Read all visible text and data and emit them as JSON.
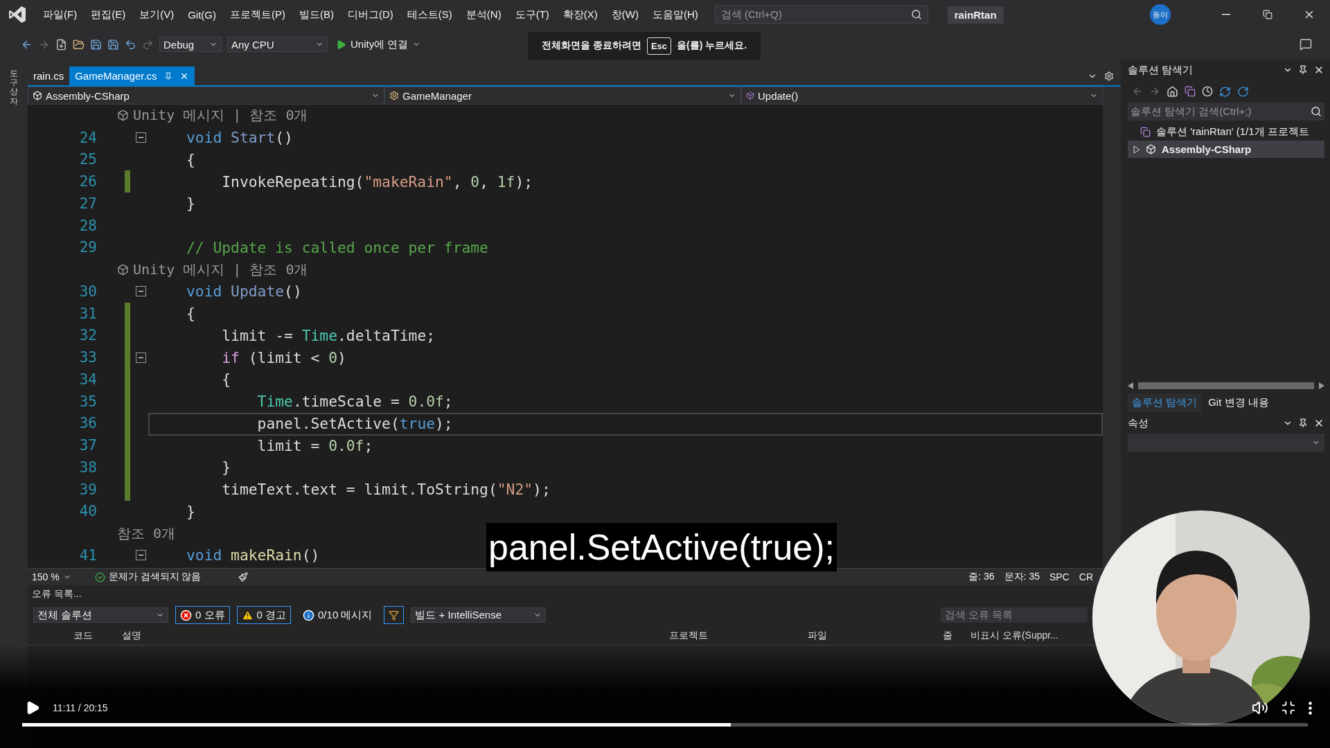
{
  "menu": [
    "파일(F)",
    "편집(E)",
    "보기(V)",
    "Git(G)",
    "프로젝트(P)",
    "빌드(B)",
    "디버그(D)",
    "테스트(S)",
    "분석(N)",
    "도구(T)",
    "확장(X)",
    "창(W)",
    "도움말(H)"
  ],
  "search": {
    "placeholder": "검색 (Ctrl+Q)"
  },
  "solution_name": "rainRtan",
  "avatar": "동이",
  "toolbar": {
    "configuration": "Debug",
    "platform": "Any CPU",
    "run": "Unity에 연결"
  },
  "fullscreen_notice": {
    "before": "전체화면을 종료하려면",
    "key": "Esc",
    "after": "을(를) 누르세요."
  },
  "toolbox_label": "도구 상자",
  "tabs": [
    {
      "label": "rain.cs",
      "selected": false
    },
    {
      "label": "GameManager.cs",
      "selected": true
    }
  ],
  "navigation": {
    "project": "Assembly-CSharp",
    "class": "GameManager",
    "member": "Update()"
  },
  "code_lines": [
    {
      "kind": "lens",
      "icon": true,
      "text": "Unity 메시지 | 참조 0개"
    },
    {
      "kind": "code",
      "number": "24",
      "fold": true,
      "changed": false,
      "current": false,
      "tokens": [
        {
          "text": "void",
          "kind": "keyword"
        },
        {
          "text": " Start",
          "kind": "message"
        },
        {
          "text": "()",
          "kind": "plain"
        }
      ]
    },
    {
      "kind": "code",
      "number": "25",
      "fold": false,
      "changed": false,
      "current": false,
      "tokens": [
        {
          "text": "{",
          "kind": "plain"
        }
      ]
    },
    {
      "kind": "code",
      "number": "26",
      "fold": false,
      "changed": true,
      "current": false,
      "tokens": [
        {
          "text": "    InvokeRepeating(",
          "kind": "plain"
        },
        {
          "text": "\"makeRain\"",
          "kind": "string"
        },
        {
          "text": ",",
          "kind": "plain"
        },
        {
          "text": " 0",
          "kind": "number"
        },
        {
          "text": ",",
          "kind": "plain"
        },
        {
          "text": " 1f",
          "kind": "number"
        },
        {
          "text": ");",
          "kind": "plain"
        }
      ]
    },
    {
      "kind": "code",
      "number": "27",
      "fold": false,
      "changed": false,
      "current": false,
      "tokens": [
        {
          "text": "}",
          "kind": "plain"
        }
      ]
    },
    {
      "kind": "code",
      "number": "28",
      "fold": false,
      "changed": false,
      "current": false
    },
    {
      "kind": "code",
      "number": "29",
      "fold": false,
      "changed": false,
      "current": false,
      "tokens": [
        {
          "text": "// Update is called once per frame",
          "kind": "comment"
        }
      ]
    },
    {
      "kind": "lens",
      "icon": true,
      "text": "Unity 메시지 | 참조 0개"
    },
    {
      "kind": "code",
      "number": "30",
      "fold": true,
      "changed": false,
      "current": false,
      "tokens": [
        {
          "text": "void",
          "kind": "keyword"
        },
        {
          "text": " Update",
          "kind": "message"
        },
        {
          "text": "()",
          "kind": "plain"
        }
      ]
    },
    {
      "kind": "code",
      "number": "31",
      "fold": false,
      "changed": true,
      "current": false,
      "tokens": [
        {
          "text": "{",
          "kind": "plain"
        }
      ]
    },
    {
      "kind": "code",
      "number": "32",
      "fold": false,
      "changed": true,
      "current": false,
      "tokens": [
        {
          "text": "    limit -= ",
          "kind": "plain"
        },
        {
          "text": "Time",
          "kind": "type"
        },
        {
          "text": ".deltaTime;",
          "kind": "plain"
        }
      ]
    },
    {
      "kind": "code",
      "number": "33",
      "fold": true,
      "changed": true,
      "current": false,
      "tokens": [
        {
          "text": "    if",
          "kind": "control"
        },
        {
          "text": " (limit < ",
          "kind": "plain"
        },
        {
          "text": "0",
          "kind": "number"
        },
        {
          "text": ")",
          "kind": "plain"
        }
      ]
    },
    {
      "kind": "code",
      "number": "34",
      "fold": false,
      "changed": true,
      "current": false,
      "tokens": [
        {
          "text": "    {",
          "kind": "plain"
        }
      ]
    },
    {
      "kind": "code",
      "number": "35",
      "fold": false,
      "changed": true,
      "current": false,
      "tokens": [
        {
          "text": "        Time",
          "kind": "type"
        },
        {
          "text": ".timeScale = ",
          "kind": "plain"
        },
        {
          "text": "0.0f",
          "kind": "number"
        },
        {
          "text": ";",
          "kind": "plain"
        }
      ]
    },
    {
      "kind": "code",
      "number": "36",
      "fold": false,
      "changed": true,
      "current": true,
      "tokens": [
        {
          "text": "        panel.SetActive(",
          "kind": "plain"
        },
        {
          "text": "true",
          "kind": "keyword"
        },
        {
          "text": ");",
          "kind": "plain"
        }
      ]
    },
    {
      "kind": "code",
      "number": "37",
      "fold": false,
      "changed": true,
      "current": false,
      "tokens": [
        {
          "text": "        limit = ",
          "kind": "plain"
        },
        {
          "text": "0.0f",
          "kind": "number"
        },
        {
          "text": ";",
          "kind": "plain"
        }
      ]
    },
    {
      "kind": "code",
      "number": "38",
      "fold": false,
      "changed": true,
      "current": false,
      "tokens": [
        {
          "text": "    }",
          "kind": "plain"
        }
      ]
    },
    {
      "kind": "code",
      "number": "39",
      "fold": false,
      "changed": true,
      "current": false,
      "tokens": [
        {
          "text": "    timeText.text = limit.ToString(",
          "kind": "plain"
        },
        {
          "text": "\"N2\"",
          "kind": "string"
        },
        {
          "text": ");",
          "kind": "plain"
        }
      ]
    },
    {
      "kind": "code",
      "number": "40",
      "fold": false,
      "changed": false,
      "current": false,
      "tokens": [
        {
          "text": "}",
          "kind": "plain"
        }
      ]
    },
    {
      "kind": "lens",
      "icon": false,
      "text": "참조 0개"
    },
    {
      "kind": "code",
      "number": "41",
      "fold": true,
      "changed": false,
      "current": false,
      "tokens": [
        {
          "text": "void",
          "kind": "keyword"
        },
        {
          "text": " makeRain",
          "kind": "method"
        },
        {
          "text": "()",
          "kind": "plain"
        }
      ]
    }
  ],
  "subtitle": "panel.SetActive(true);",
  "status_bar": {
    "zoom": "150 %",
    "issues": "문제가 검색되지 않음",
    "line": "줄: 36",
    "column": "문자: 35",
    "whitespace": "SPC",
    "line_ending": "CR"
  },
  "error_list": {
    "title": "오류 목록...",
    "scope": "전체 솔루션",
    "filters": [
      {
        "kind": "error",
        "label": "0 오류",
        "on": true
      },
      {
        "kind": "warning",
        "label": "0 경고",
        "on": true
      },
      {
        "kind": "message",
        "label": "0/10 메시지",
        "on": false
      }
    ],
    "source": "빌드 + IntelliSense",
    "search_placeholder": "검색 오류 목록",
    "columns": [
      "코드",
      "설명",
      "프로젝트",
      "파일",
      "줄",
      "비표시 오류(Suppr..."
    ]
  },
  "solution_explorer": {
    "title": "솔루션 탐색기",
    "search_placeholder": "솔루션 탐색기 검색(Ctrl+;)",
    "tree": [
      {
        "label": "솔루션 'rainRtan' (1/1개 프로젝트",
        "selected": false,
        "children": [
          {
            "label": "Assembly-CSharp",
            "selected": true,
            "expanded": false
          }
        ]
      }
    ]
  },
  "bottom_tabs": [
    {
      "label": "솔루션 탐색기",
      "selected": true
    },
    {
      "label": "Git 변경 내용",
      "selected": false
    }
  ],
  "properties": {
    "title": "속성"
  },
  "player": {
    "time": "11:11 / 20:15",
    "level": 0.551
  }
}
